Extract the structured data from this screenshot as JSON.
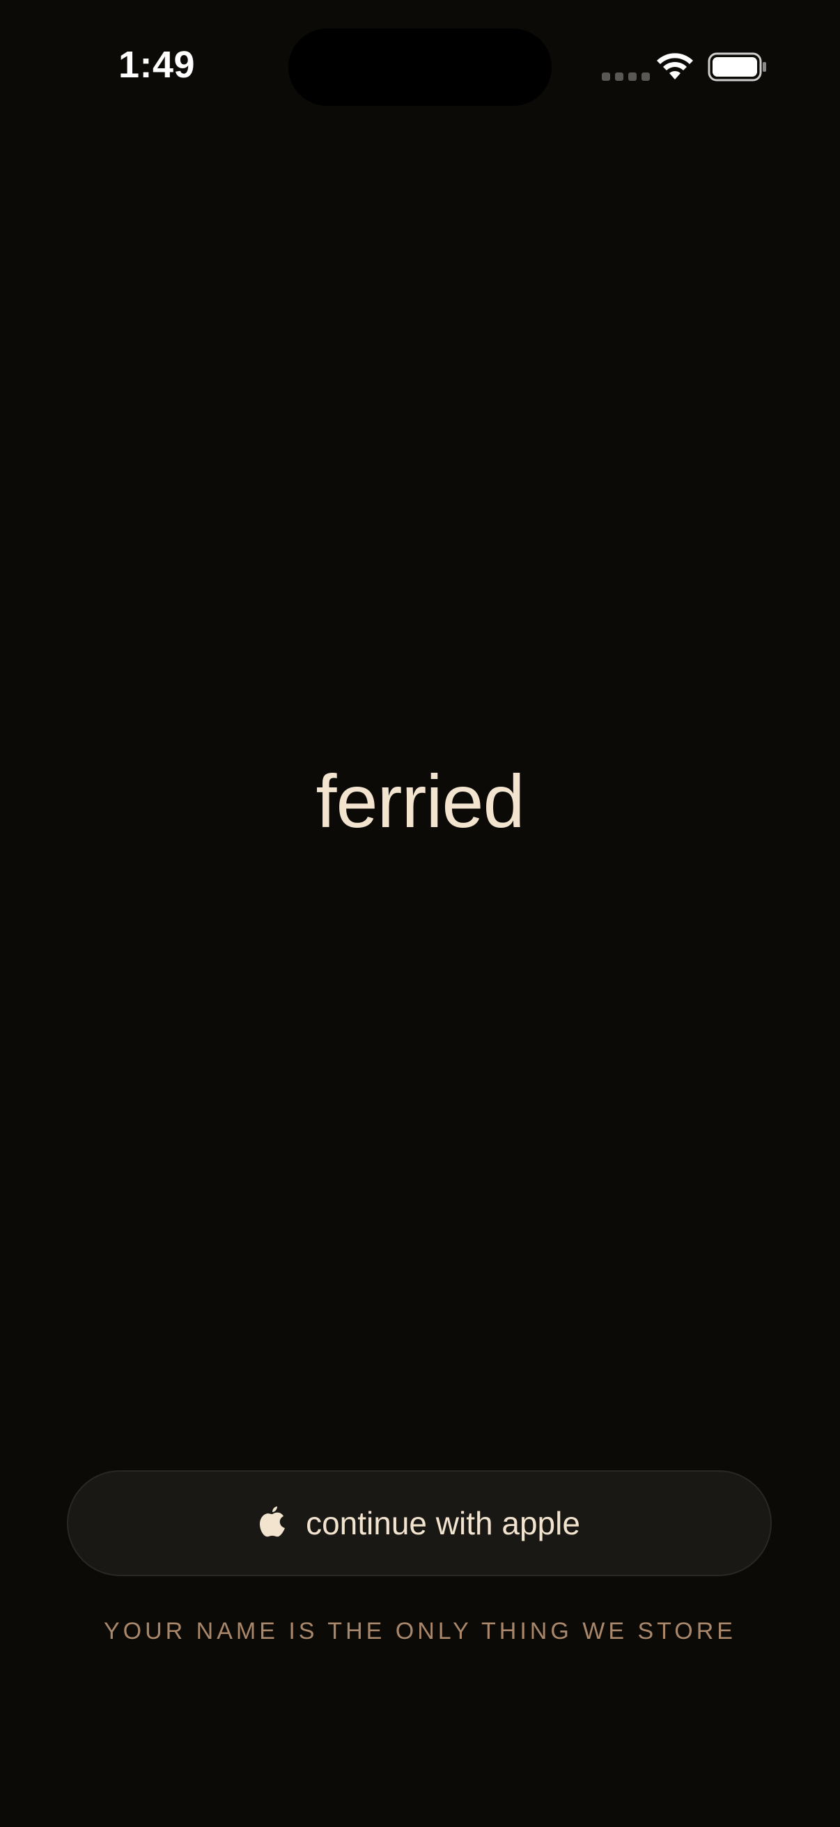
{
  "status_bar": {
    "time": "1:49",
    "wifi_icon": "wifi-icon",
    "battery_icon": "battery-icon"
  },
  "brand": {
    "title": "ferried"
  },
  "sign_in": {
    "icon": "apple-icon",
    "label": "continue with apple"
  },
  "privacy_note": "YOUR NAME IS THE ONLY THING WE STORE",
  "colors": {
    "background": "#0c0a07",
    "title": "#f2e4cf",
    "button_bg": "#1a1814",
    "note": "#a9876a"
  }
}
